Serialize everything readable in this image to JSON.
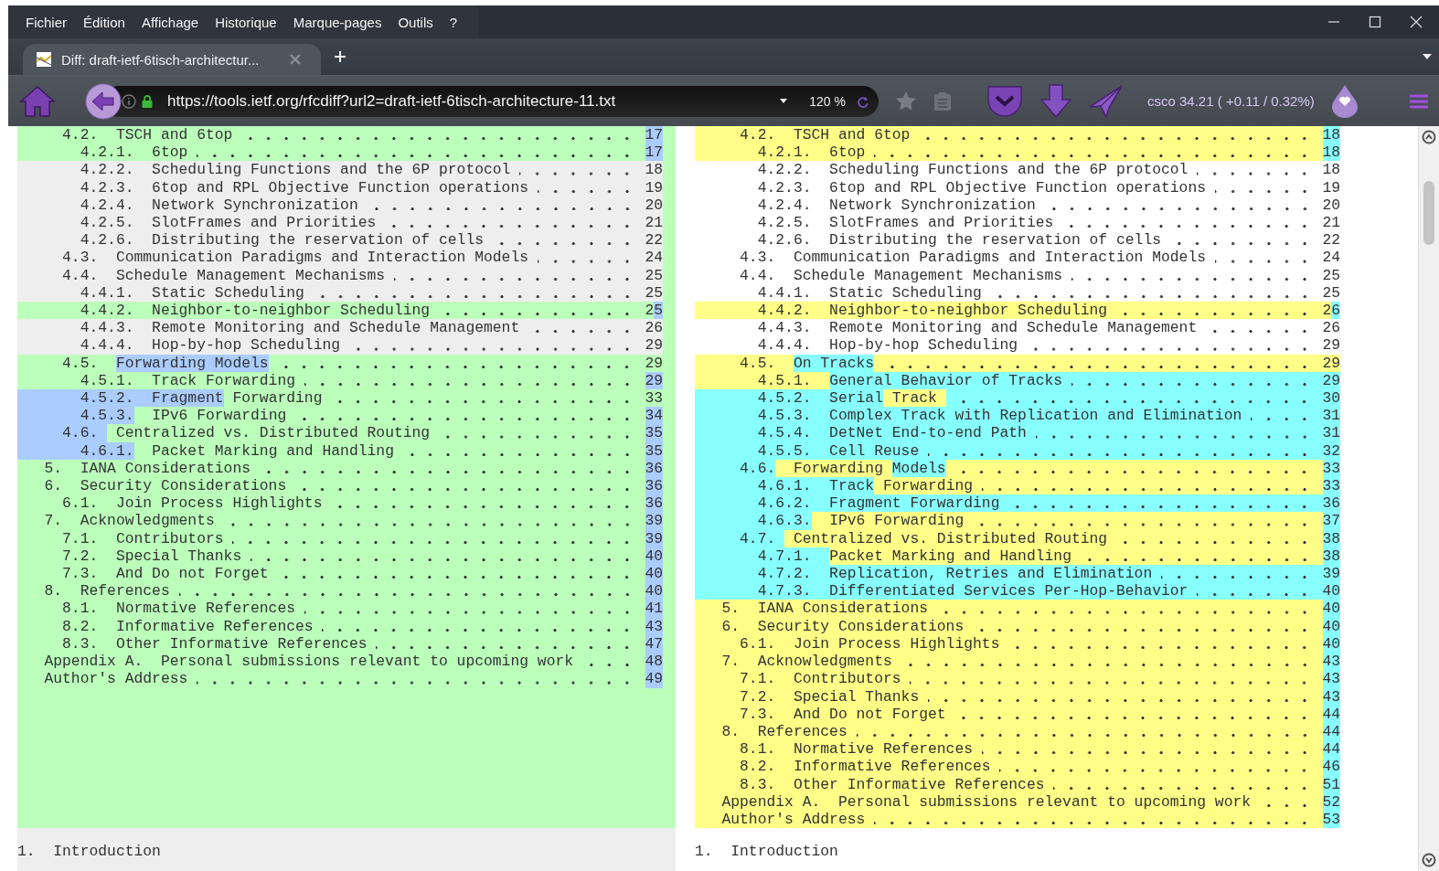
{
  "menu_bar": {
    "items": [
      "Fichier",
      "Édition",
      "Affichage",
      "Historique",
      "Marque-pages",
      "Outils",
      "?"
    ]
  },
  "tabs": [
    {
      "title": "Diff: draft-ietf-6tisch-architectur...",
      "selected": true
    }
  ],
  "address_bar": {
    "url": "https://tools.ietf.org/rfcdiff?url2=draft-ietf-6tisch-architecture-11.txt",
    "zoom": "120 %"
  },
  "toolbar": {
    "stock_ticker": "csco 34.21 ( +0.11 / 0.32%)"
  },
  "diff": {
    "left": {
      "rows": [
        {
          "kind": "changed",
          "segments": [
            {
              "kind": "text",
              "text": "     4.2.  TSCH and 6top",
              "hl": false
            },
            {
              "kind": "leader",
              "hl": false
            },
            {
              "kind": "text",
              "text": "17",
              "hl": true
            }
          ]
        },
        {
          "kind": "changed",
          "segments": [
            {
              "kind": "text",
              "text": "       4.2.1.  6top",
              "hl": false
            },
            {
              "kind": "leader",
              "hl": false
            },
            {
              "kind": "text",
              "text": "17",
              "hl": true
            }
          ]
        },
        {
          "kind": "same",
          "segments": [
            {
              "kind": "text",
              "text": "       4.2.2.  Scheduling Functions and the 6P protocol",
              "hl": false
            },
            {
              "kind": "leader",
              "hl": false
            },
            {
              "kind": "text",
              "text": "18",
              "hl": false
            }
          ]
        },
        {
          "kind": "same",
          "segments": [
            {
              "kind": "text",
              "text": "       4.2.3.  6top and RPL Objective Function operations",
              "hl": false
            },
            {
              "kind": "leader",
              "hl": false
            },
            {
              "kind": "text",
              "text": "19",
              "hl": false
            }
          ]
        },
        {
          "kind": "same",
          "segments": [
            {
              "kind": "text",
              "text": "       4.2.4.  Network Synchronization",
              "hl": false
            },
            {
              "kind": "leader",
              "hl": false
            },
            {
              "kind": "text",
              "text": "20",
              "hl": false
            }
          ]
        },
        {
          "kind": "same",
          "segments": [
            {
              "kind": "text",
              "text": "       4.2.5.  SlotFrames and Priorities",
              "hl": false
            },
            {
              "kind": "leader",
              "hl": false
            },
            {
              "kind": "text",
              "text": "21",
              "hl": false
            }
          ]
        },
        {
          "kind": "same",
          "segments": [
            {
              "kind": "text",
              "text": "       4.2.6.  Distributing the reservation of cells",
              "hl": false
            },
            {
              "kind": "leader",
              "hl": false
            },
            {
              "kind": "text",
              "text": "22",
              "hl": false
            }
          ]
        },
        {
          "kind": "same",
          "segments": [
            {
              "kind": "text",
              "text": "     4.3.  Communication Paradigms and Interaction Models",
              "hl": false
            },
            {
              "kind": "leader",
              "hl": false
            },
            {
              "kind": "text",
              "text": "24",
              "hl": false
            }
          ]
        },
        {
          "kind": "same",
          "segments": [
            {
              "kind": "text",
              "text": "     4.4.  Schedule Management Mechanisms",
              "hl": false
            },
            {
              "kind": "leader",
              "hl": false
            },
            {
              "kind": "text",
              "text": "25",
              "hl": false
            }
          ]
        },
        {
          "kind": "same",
          "segments": [
            {
              "kind": "text",
              "text": "       4.4.1.  Static Scheduling",
              "hl": false
            },
            {
              "kind": "leader",
              "hl": false
            },
            {
              "kind": "text",
              "text": "25",
              "hl": false
            }
          ]
        },
        {
          "kind": "changed",
          "segments": [
            {
              "kind": "text",
              "text": "       4.4.2.  Neighbor-to-neighbor Scheduling",
              "hl": false
            },
            {
              "kind": "leader",
              "hl": false
            },
            {
              "kind": "text",
              "text": "2",
              "hl": false
            },
            {
              "kind": "text",
              "text": "5",
              "hl": true
            }
          ]
        },
        {
          "kind": "same",
          "segments": [
            {
              "kind": "text",
              "text": "       4.4.3.  Remote Monitoring and Schedule Management",
              "hl": false
            },
            {
              "kind": "leader",
              "hl": false
            },
            {
              "kind": "text",
              "text": "26",
              "hl": false
            }
          ]
        },
        {
          "kind": "same",
          "segments": [
            {
              "kind": "text",
              "text": "       4.4.4.  Hop-by-hop Scheduling",
              "hl": false
            },
            {
              "kind": "leader",
              "hl": false
            },
            {
              "kind": "text",
              "text": "29",
              "hl": false
            }
          ]
        },
        {
          "kind": "changed",
          "segments": [
            {
              "kind": "text",
              "text": "     4.5.  ",
              "hl": false
            },
            {
              "kind": "text",
              "text": "Forwarding Models",
              "hl": true
            },
            {
              "kind": "leader",
              "hl": false
            },
            {
              "kind": "text",
              "text": "29",
              "hl": false
            }
          ]
        },
        {
          "kind": "changed",
          "segments": [
            {
              "kind": "text",
              "text": "       4.5.1.  Track Forwarding",
              "hl": false
            },
            {
              "kind": "leader",
              "hl": false
            },
            {
              "kind": "text",
              "text": "29",
              "hl": true
            }
          ]
        },
        {
          "kind": "changed",
          "segments": [
            {
              "kind": "text",
              "text": "       4.5.2.  Fragment",
              "hl": true
            },
            {
              "kind": "text",
              "text": " Forwarding",
              "hl": false
            },
            {
              "kind": "leader",
              "hl": false
            },
            {
              "kind": "text",
              "text": "33",
              "hl": false
            }
          ]
        },
        {
          "kind": "changed",
          "segments": [
            {
              "kind": "text",
              "text": "       4.5.3.",
              "hl": true
            },
            {
              "kind": "text",
              "text": "  IPv6 Forwarding",
              "hl": false
            },
            {
              "kind": "leader",
              "hl": false
            },
            {
              "kind": "text",
              "text": "34",
              "hl": true
            }
          ]
        },
        {
          "kind": "changed",
          "segments": [
            {
              "kind": "text",
              "text": "     4.6. ",
              "hl": true
            },
            {
              "kind": "text",
              "text": " Centralized vs. Distributed Routing",
              "hl": false
            },
            {
              "kind": "leader",
              "hl": false
            },
            {
              "kind": "text",
              "text": "35",
              "hl": true
            }
          ]
        },
        {
          "kind": "changed",
          "segments": [
            {
              "kind": "text",
              "text": "       4.6.1.",
              "hl": true
            },
            {
              "kind": "text",
              "text": "  Packet Marking and Handling",
              "hl": false
            },
            {
              "kind": "leader",
              "hl": false
            },
            {
              "kind": "text",
              "text": "35",
              "hl": true
            }
          ]
        },
        {
          "kind": "changed",
          "segments": [
            {
              "kind": "text",
              "text": "   5.  IANA Considerations",
              "hl": false
            },
            {
              "kind": "leader",
              "hl": false
            },
            {
              "kind": "text",
              "text": "36",
              "hl": true
            }
          ]
        },
        {
          "kind": "changed",
          "segments": [
            {
              "kind": "text",
              "text": "   6.  Security Considerations",
              "hl": false
            },
            {
              "kind": "leader",
              "hl": false
            },
            {
              "kind": "text",
              "text": "36",
              "hl": true
            }
          ]
        },
        {
          "kind": "changed",
          "segments": [
            {
              "kind": "text",
              "text": "     6.1.  Join Process Highlights",
              "hl": false
            },
            {
              "kind": "leader",
              "hl": false
            },
            {
              "kind": "text",
              "text": "36",
              "hl": true
            }
          ]
        },
        {
          "kind": "changed",
          "segments": [
            {
              "kind": "text",
              "text": "   7.  Acknowledgments",
              "hl": false
            },
            {
              "kind": "leader",
              "hl": false
            },
            {
              "kind": "text",
              "text": "39",
              "hl": true
            }
          ]
        },
        {
          "kind": "changed",
          "segments": [
            {
              "kind": "text",
              "text": "     7.1.  Contributors",
              "hl": false
            },
            {
              "kind": "leader",
              "hl": false
            },
            {
              "kind": "text",
              "text": "39",
              "hl": true
            }
          ]
        },
        {
          "kind": "changed",
          "segments": [
            {
              "kind": "text",
              "text": "     7.2.  Special Thanks",
              "hl": false
            },
            {
              "kind": "leader",
              "hl": false
            },
            {
              "kind": "text",
              "text": "40",
              "hl": true
            }
          ]
        },
        {
          "kind": "changed",
          "segments": [
            {
              "kind": "text",
              "text": "     7.3.  And Do not Forget",
              "hl": false
            },
            {
              "kind": "leader",
              "hl": false
            },
            {
              "kind": "text",
              "text": "40",
              "hl": true
            }
          ]
        },
        {
          "kind": "changed",
          "segments": [
            {
              "kind": "text",
              "text": "   8.  References",
              "hl": false
            },
            {
              "kind": "leader",
              "hl": false
            },
            {
              "kind": "text",
              "text": "40",
              "hl": true
            }
          ]
        },
        {
          "kind": "changed",
          "segments": [
            {
              "kind": "text",
              "text": "     8.1.  Normative References",
              "hl": false
            },
            {
              "kind": "leader",
              "hl": false
            },
            {
              "kind": "text",
              "text": "41",
              "hl": true
            }
          ]
        },
        {
          "kind": "changed",
          "segments": [
            {
              "kind": "text",
              "text": "     8.2.  Informative References",
              "hl": false
            },
            {
              "kind": "leader",
              "hl": false
            },
            {
              "kind": "text",
              "text": "43",
              "hl": true
            }
          ]
        },
        {
          "kind": "changed",
          "segments": [
            {
              "kind": "text",
              "text": "     8.3.  Other Informative References",
              "hl": false
            },
            {
              "kind": "leader",
              "hl": false
            },
            {
              "kind": "text",
              "text": "47",
              "hl": true
            }
          ]
        },
        {
          "kind": "changed",
          "segments": [
            {
              "kind": "text",
              "text": "   Appendix A.  Personal submissions relevant to upcoming work",
              "hl": false
            },
            {
              "kind": "leader",
              "hl": false
            },
            {
              "kind": "text",
              "text": "48",
              "hl": true
            }
          ]
        },
        {
          "kind": "changed",
          "segments": [
            {
              "kind": "text",
              "text": "   Author's Address",
              "hl": false
            },
            {
              "kind": "leader",
              "hl": false
            },
            {
              "kind": "text",
              "text": "49",
              "hl": true
            }
          ]
        }
      ],
      "section_line": "1.  Introduction"
    },
    "right": {
      "rows": [
        {
          "kind": "changed",
          "segments": [
            {
              "kind": "text",
              "text": "     4.2.  TSCH and 6top",
              "hl": false
            },
            {
              "kind": "leader",
              "hl": false
            },
            {
              "kind": "text",
              "text": "18",
              "hl": true
            }
          ]
        },
        {
          "kind": "changed",
          "segments": [
            {
              "kind": "text",
              "text": "       4.2.1.  6top",
              "hl": false
            },
            {
              "kind": "leader",
              "hl": false
            },
            {
              "kind": "text",
              "text": "18",
              "hl": true
            }
          ]
        },
        {
          "kind": "same",
          "segments": [
            {
              "kind": "text",
              "text": "       4.2.2.  Scheduling Functions and the 6P protocol",
              "hl": false
            },
            {
              "kind": "leader",
              "hl": false
            },
            {
              "kind": "text",
              "text": "18",
              "hl": false
            }
          ]
        },
        {
          "kind": "same",
          "segments": [
            {
              "kind": "text",
              "text": "       4.2.3.  6top and RPL Objective Function operations",
              "hl": false
            },
            {
              "kind": "leader",
              "hl": false
            },
            {
              "kind": "text",
              "text": "19",
              "hl": false
            }
          ]
        },
        {
          "kind": "same",
          "segments": [
            {
              "kind": "text",
              "text": "       4.2.4.  Network Synchronization",
              "hl": false
            },
            {
              "kind": "leader",
              "hl": false
            },
            {
              "kind": "text",
              "text": "20",
              "hl": false
            }
          ]
        },
        {
          "kind": "same",
          "segments": [
            {
              "kind": "text",
              "text": "       4.2.5.  SlotFrames and Priorities",
              "hl": false
            },
            {
              "kind": "leader",
              "hl": false
            },
            {
              "kind": "text",
              "text": "21",
              "hl": false
            }
          ]
        },
        {
          "kind": "same",
          "segments": [
            {
              "kind": "text",
              "text": "       4.2.6.  Distributing the reservation of cells",
              "hl": false
            },
            {
              "kind": "leader",
              "hl": false
            },
            {
              "kind": "text",
              "text": "22",
              "hl": false
            }
          ]
        },
        {
          "kind": "same",
          "segments": [
            {
              "kind": "text",
              "text": "     4.3.  Communication Paradigms and Interaction Models",
              "hl": false
            },
            {
              "kind": "leader",
              "hl": false
            },
            {
              "kind": "text",
              "text": "24",
              "hl": false
            }
          ]
        },
        {
          "kind": "same",
          "segments": [
            {
              "kind": "text",
              "text": "     4.4.  Schedule Management Mechanisms",
              "hl": false
            },
            {
              "kind": "leader",
              "hl": false
            },
            {
              "kind": "text",
              "text": "25",
              "hl": false
            }
          ]
        },
        {
          "kind": "same",
          "segments": [
            {
              "kind": "text",
              "text": "       4.4.1.  Static Scheduling",
              "hl": false
            },
            {
              "kind": "leader",
              "hl": false
            },
            {
              "kind": "text",
              "text": "25",
              "hl": false
            }
          ]
        },
        {
          "kind": "changed",
          "segments": [
            {
              "kind": "text",
              "text": "       4.4.2.  Neighbor-to-neighbor Scheduling",
              "hl": false
            },
            {
              "kind": "leader",
              "hl": false
            },
            {
              "kind": "text",
              "text": "2",
              "hl": false
            },
            {
              "kind": "text",
              "text": "6",
              "hl": true
            }
          ]
        },
        {
          "kind": "same",
          "segments": [
            {
              "kind": "text",
              "text": "       4.4.3.  Remote Monitoring and Schedule Management",
              "hl": false
            },
            {
              "kind": "leader",
              "hl": false
            },
            {
              "kind": "text",
              "text": "26",
              "hl": false
            }
          ]
        },
        {
          "kind": "same",
          "segments": [
            {
              "kind": "text",
              "text": "       4.4.4.  Hop-by-hop Scheduling",
              "hl": false
            },
            {
              "kind": "leader",
              "hl": false
            },
            {
              "kind": "text",
              "text": "29",
              "hl": false
            }
          ]
        },
        {
          "kind": "changed",
          "segments": [
            {
              "kind": "text",
              "text": "     4.5.  ",
              "hl": false
            },
            {
              "kind": "text",
              "text": "On Tracks",
              "hl": true
            },
            {
              "kind": "leader",
              "hl": false
            },
            {
              "kind": "text",
              "text": "29",
              "hl": false
            }
          ]
        },
        {
          "kind": "changed",
          "segments": [
            {
              "kind": "text",
              "text": "       4.5.1.  ",
              "hl": false
            },
            {
              "kind": "text",
              "text": "General Behavior of Tracks",
              "hl": true
            },
            {
              "kind": "leader",
              "hl": true
            },
            {
              "kind": "text",
              "text": "29",
              "hl": true
            }
          ]
        },
        {
          "kind": "changed",
          "segments": [
            {
              "kind": "text",
              "text": "       4.5.2.  Serial",
              "hl": true
            },
            {
              "kind": "text",
              "text": " Track ",
              "hl": false
            },
            {
              "kind": "leader",
              "hl": true
            },
            {
              "kind": "text",
              "text": "30",
              "hl": true
            }
          ]
        },
        {
          "kind": "changed",
          "segments": [
            {
              "kind": "text",
              "text": "       4.5.3.  Complex Track with Replication and Elimination",
              "hl": true
            },
            {
              "kind": "leader",
              "hl": true
            },
            {
              "kind": "text",
              "text": "31",
              "hl": true
            }
          ]
        },
        {
          "kind": "changed",
          "segments": [
            {
              "kind": "text",
              "text": "       4.5.4.  DetNet End-to-end Path",
              "hl": true
            },
            {
              "kind": "leader",
              "hl": true
            },
            {
              "kind": "text",
              "text": "31",
              "hl": true
            }
          ]
        },
        {
          "kind": "changed",
          "segments": [
            {
              "kind": "text",
              "text": "       4.5.5.  Cell Reuse",
              "hl": true
            },
            {
              "kind": "leader",
              "hl": true
            },
            {
              "kind": "text",
              "text": "32",
              "hl": true
            }
          ]
        },
        {
          "kind": "changed",
          "segments": [
            {
              "kind": "text",
              "text": "     4.6.",
              "hl": true
            },
            {
              "kind": "text",
              "text": "  Forwarding ",
              "hl": false
            },
            {
              "kind": "text",
              "text": "Models",
              "hl": true
            },
            {
              "kind": "leader",
              "hl": false
            },
            {
              "kind": "text",
              "text": "33",
              "hl": true
            }
          ]
        },
        {
          "kind": "changed",
          "segments": [
            {
              "kind": "text",
              "text": "       4.6.1.  Track",
              "hl": true
            },
            {
              "kind": "text",
              "text": " Forwarding",
              "hl": false
            },
            {
              "kind": "leader",
              "hl": false
            },
            {
              "kind": "text",
              "text": "33",
              "hl": true
            }
          ]
        },
        {
          "kind": "changed",
          "segments": [
            {
              "kind": "text",
              "text": "       4.6.2.  Fragment Forwarding",
              "hl": true
            },
            {
              "kind": "leader",
              "hl": true
            },
            {
              "kind": "text",
              "text": "36",
              "hl": true
            }
          ]
        },
        {
          "kind": "changed",
          "segments": [
            {
              "kind": "text",
              "text": "       4.6.3.",
              "hl": true
            },
            {
              "kind": "text",
              "text": "  IPv6 Forwarding",
              "hl": false
            },
            {
              "kind": "leader",
              "hl": false
            },
            {
              "kind": "text",
              "text": "37",
              "hl": true
            }
          ]
        },
        {
          "kind": "changed",
          "segments": [
            {
              "kind": "text",
              "text": "     4.7. ",
              "hl": true
            },
            {
              "kind": "text",
              "text": " Centralized vs. Distributed Routing",
              "hl": false
            },
            {
              "kind": "leader",
              "hl": false
            },
            {
              "kind": "text",
              "text": "38",
              "hl": true
            }
          ]
        },
        {
          "kind": "changed",
          "segments": [
            {
              "kind": "text",
              "text": "       4.7.1.  ",
              "hl": true
            },
            {
              "kind": "text",
              "text": "Packet Marking and Handling",
              "hl": false
            },
            {
              "kind": "leader",
              "hl": false
            },
            {
              "kind": "text",
              "text": "38",
              "hl": true
            }
          ]
        },
        {
          "kind": "changed",
          "segments": [
            {
              "kind": "text",
              "text": "       4.7.2.  Replication, Retries and Elimination",
              "hl": true
            },
            {
              "kind": "leader",
              "hl": true
            },
            {
              "kind": "text",
              "text": "39",
              "hl": true
            }
          ]
        },
        {
          "kind": "changed",
          "segments": [
            {
              "kind": "text",
              "text": "       4.7.3.  Differentiated Services Per-Hop-Behavior",
              "hl": true
            },
            {
              "kind": "leader",
              "hl": true
            },
            {
              "kind": "text",
              "text": "40",
              "hl": true
            }
          ]
        },
        {
          "kind": "changed",
          "segments": [
            {
              "kind": "text",
              "text": "   5.  IANA Considerations",
              "hl": false
            },
            {
              "kind": "leader",
              "hl": false
            },
            {
              "kind": "text",
              "text": "40",
              "hl": true
            }
          ]
        },
        {
          "kind": "changed",
          "segments": [
            {
              "kind": "text",
              "text": "   6.  Security Considerations",
              "hl": false
            },
            {
              "kind": "leader",
              "hl": false
            },
            {
              "kind": "text",
              "text": "40",
              "hl": true
            }
          ]
        },
        {
          "kind": "changed",
          "segments": [
            {
              "kind": "text",
              "text": "     6.1.  Join Process Highlights",
              "hl": false
            },
            {
              "kind": "leader",
              "hl": false
            },
            {
              "kind": "text",
              "text": "40",
              "hl": true
            }
          ]
        },
        {
          "kind": "changed",
          "segments": [
            {
              "kind": "text",
              "text": "   7.  Acknowledgments",
              "hl": false
            },
            {
              "kind": "leader",
              "hl": false
            },
            {
              "kind": "text",
              "text": "43",
              "hl": true
            }
          ]
        },
        {
          "kind": "changed",
          "segments": [
            {
              "kind": "text",
              "text": "     7.1.  Contributors",
              "hl": false
            },
            {
              "kind": "leader",
              "hl": false
            },
            {
              "kind": "text",
              "text": "43",
              "hl": true
            }
          ]
        },
        {
          "kind": "changed",
          "segments": [
            {
              "kind": "text",
              "text": "     7.2.  Special Thanks",
              "hl": false
            },
            {
              "kind": "leader",
              "hl": false
            },
            {
              "kind": "text",
              "text": "43",
              "hl": true
            }
          ]
        },
        {
          "kind": "changed",
          "segments": [
            {
              "kind": "text",
              "text": "     7.3.  And Do not Forget",
              "hl": false
            },
            {
              "kind": "leader",
              "hl": false
            },
            {
              "kind": "text",
              "text": "44",
              "hl": true
            }
          ]
        },
        {
          "kind": "changed",
          "segments": [
            {
              "kind": "text",
              "text": "   8.  References",
              "hl": false
            },
            {
              "kind": "leader",
              "hl": false
            },
            {
              "kind": "text",
              "text": "44",
              "hl": true
            }
          ]
        },
        {
          "kind": "changed",
          "segments": [
            {
              "kind": "text",
              "text": "     8.1.  Normative References",
              "hl": false
            },
            {
              "kind": "leader",
              "hl": false
            },
            {
              "kind": "text",
              "text": "44",
              "hl": true
            }
          ]
        },
        {
          "kind": "changed",
          "segments": [
            {
              "kind": "text",
              "text": "     8.2.  Informative References",
              "hl": false
            },
            {
              "kind": "leader",
              "hl": false
            },
            {
              "kind": "text",
              "text": "46",
              "hl": true
            }
          ]
        },
        {
          "kind": "changed",
          "segments": [
            {
              "kind": "text",
              "text": "     8.3.  Other Informative References",
              "hl": false
            },
            {
              "kind": "leader",
              "hl": false
            },
            {
              "kind": "text",
              "text": "51",
              "hl": true
            }
          ]
        },
        {
          "kind": "changed",
          "segments": [
            {
              "kind": "text",
              "text": "   Appendix A.  Personal submissions relevant to upcoming work",
              "hl": false
            },
            {
              "kind": "leader",
              "hl": false
            },
            {
              "kind": "text",
              "text": "52",
              "hl": true
            }
          ]
        },
        {
          "kind": "changed",
          "segments": [
            {
              "kind": "text",
              "text": "   Author's Address",
              "hl": false
            },
            {
              "kind": "leader",
              "hl": false
            },
            {
              "kind": "text",
              "text": "53",
              "hl": true
            }
          ]
        }
      ],
      "section_line": "1.  Introduction"
    }
  }
}
